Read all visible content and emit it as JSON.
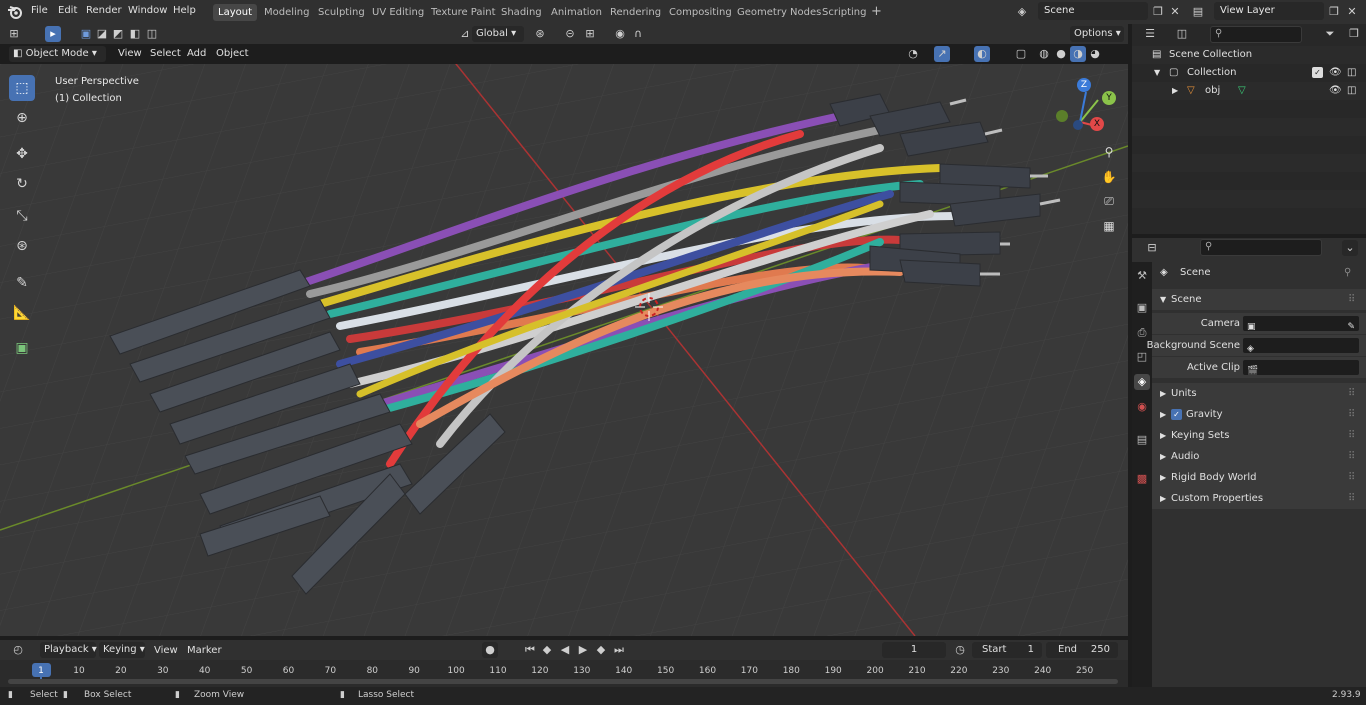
{
  "menus": [
    "File",
    "Edit",
    "Render",
    "Window",
    "Help"
  ],
  "workspaces": [
    "Layout",
    "Modeling",
    "Sculpting",
    "UV Editing",
    "Texture Paint",
    "Shading",
    "Animation",
    "Rendering",
    "Compositing",
    "Geometry Nodes",
    "Scripting"
  ],
  "active_workspace": "Layout",
  "scene_name": "Scene",
  "view_layer": "View Layer",
  "viewport_header": {
    "mode": "Object Mode",
    "view": "View",
    "select": "Select",
    "add": "Add",
    "object": "Object",
    "orientation": "Global",
    "options": "Options"
  },
  "viewport_overlay": {
    "perspective": "User Perspective",
    "collection": "(1) Collection"
  },
  "gizmo_axes": {
    "x": "X",
    "y": "Y",
    "z": "Z"
  },
  "outliner": {
    "search_placeholder": "",
    "rows": [
      "Scene Collection",
      "Collection",
      "obj"
    ]
  },
  "properties": {
    "context": "Scene",
    "panel_title": "Scene",
    "camera_label": "Camera",
    "background_scene_label": "Background Scene",
    "active_clip_label": "Active Clip",
    "sections": [
      "Units",
      "Gravity",
      "Keying Sets",
      "Audio",
      "Rigid Body World",
      "Custom Properties"
    ]
  },
  "timeline": {
    "playback": "Playback",
    "keying": "Keying",
    "view": "View",
    "marker": "Marker",
    "current_frame": "1",
    "start_label": "Start",
    "start_value": "1",
    "end_label": "End",
    "end_value": "250",
    "ticks": [
      "1",
      "10",
      "20",
      "30",
      "40",
      "50",
      "60",
      "70",
      "80",
      "90",
      "100",
      "110",
      "120",
      "130",
      "140",
      "150",
      "160",
      "170",
      "180",
      "190",
      "200",
      "210",
      "220",
      "230",
      "240",
      "250"
    ]
  },
  "statusbar": {
    "select": "Select",
    "box_select": "Box Select",
    "zoom_view": "Zoom View",
    "lasso_select": "Lasso Select",
    "version": "2.93.9"
  },
  "colors": {
    "accent": "#4772b3",
    "header": "#303030",
    "viewport": "#393939"
  }
}
